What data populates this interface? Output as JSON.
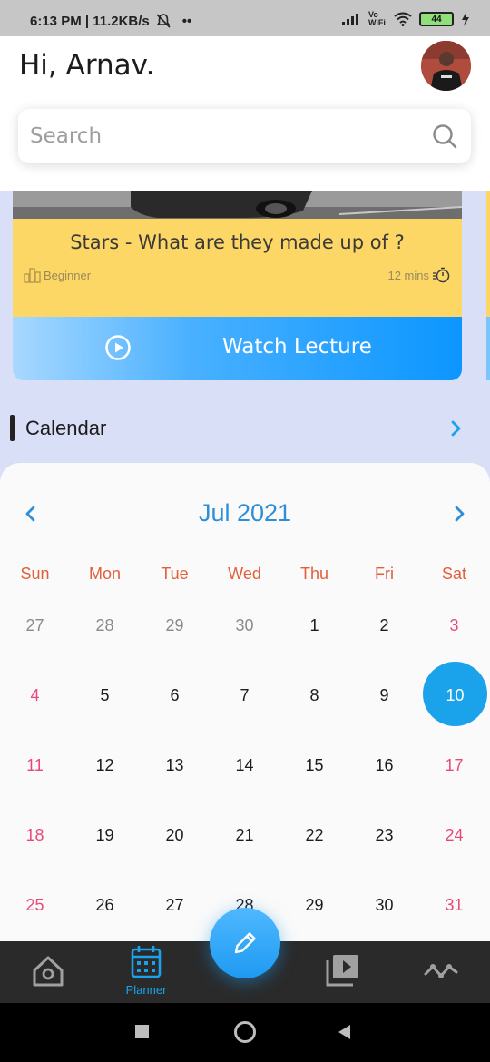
{
  "status_bar": {
    "time_speed": "6:13 PM | 11.2KB/s",
    "dots": "••",
    "volte": "Vo\nWiFi",
    "battery": "44"
  },
  "header": {
    "greeting": "Hi, Arnav."
  },
  "search": {
    "placeholder": "Search"
  },
  "lecture_card": {
    "title": "Stars - What are they made up of ?",
    "level": "Beginner",
    "duration": "12 mins",
    "watch_label": "Watch Lecture"
  },
  "calendar_section": {
    "heading": "Calendar"
  },
  "calendar": {
    "month": "Jul 2021",
    "weekdays": [
      "Sun",
      "Mon",
      "Tue",
      "Wed",
      "Thu",
      "Fri",
      "Sat"
    ],
    "weeks": [
      [
        "27",
        "28",
        "29",
        "30",
        "1",
        "2",
        "3"
      ],
      [
        "4",
        "5",
        "6",
        "7",
        "8",
        "9",
        "10"
      ],
      [
        "11",
        "12",
        "13",
        "14",
        "15",
        "16",
        "17"
      ],
      [
        "18",
        "19",
        "20",
        "21",
        "22",
        "23",
        "24"
      ],
      [
        "25",
        "26",
        "27",
        "28",
        "29",
        "30",
        "31"
      ]
    ],
    "selected_day": "10",
    "colors": {
      "accent": "#1aa3ea",
      "weekday": "#e15f3a",
      "weekend": "#e84a78",
      "other_month": "#8a8a8a"
    }
  },
  "bottom_nav": {
    "items": [
      {
        "icon": "home-icon",
        "label": ""
      },
      {
        "icon": "calendar-icon",
        "label": "Planner"
      },
      {
        "icon": "pencil-icon",
        "label": ""
      },
      {
        "icon": "video-library-icon",
        "label": ""
      },
      {
        "icon": "activity-icon",
        "label": ""
      }
    ]
  },
  "system_nav": {
    "icons": [
      "recents-icon",
      "home-circle-icon",
      "back-icon"
    ]
  }
}
